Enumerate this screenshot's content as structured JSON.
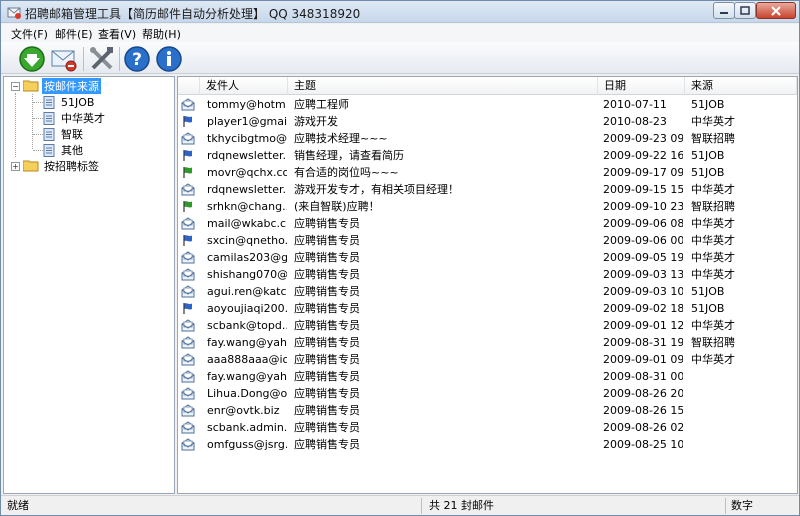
{
  "window": {
    "title": "招聘邮箱管理工具【简历邮件自动分析处理】 QQ 348318920"
  },
  "menu": [
    {
      "label": "文件(F)"
    },
    {
      "label": "邮件(E)"
    },
    {
      "label": "查看(V)"
    },
    {
      "label": "帮助(H)"
    }
  ],
  "toolbar": [
    {
      "icon": "download-icon"
    },
    {
      "icon": "mail-delete-icon"
    },
    {
      "icon": "tools-icon"
    },
    {
      "icon": "help-icon"
    },
    {
      "icon": "info-icon"
    }
  ],
  "tree": {
    "root1": "按邮件来源",
    "children": [
      "51JOB",
      "中华英才",
      "智联",
      "其他"
    ],
    "root2": "按招聘标签"
  },
  "list": {
    "columns": [
      "发件人",
      "主题",
      "日期",
      "来源"
    ],
    "rows": [
      {
        "icon": "mail-read-icon",
        "sender": "tommy@hotm...",
        "subject": "应聘工程师",
        "date": "2010-07-11",
        "source": "51JOB"
      },
      {
        "icon": "flag-blue-icon",
        "sender": "player1@gmai...",
        "subject": "游戏开发",
        "date": "2010-08-23",
        "source": "中华英才"
      },
      {
        "icon": "mail-read-icon",
        "sender": "tkhycibgtmo@...",
        "subject": "应聘技术经理~~~",
        "date": "2009-09-23 09...",
        "source": "智联招聘"
      },
      {
        "icon": "flag-blue-icon",
        "sender": "rdqnewsletter...",
        "subject": "销售经理，请查看简历",
        "date": "2009-09-22 16...",
        "source": "51JOB"
      },
      {
        "icon": "flag-green-icon",
        "sender": "movr@qchx.co...",
        "subject": "有合适的岗位吗~~~",
        "date": "2009-09-17 09...",
        "source": "51JOB"
      },
      {
        "icon": "mail-read-icon",
        "sender": "rdqnewsletter...",
        "subject": "游戏开发专才，有相关项目经理！",
        "date": "2009-09-15 15...",
        "source": "中华英才"
      },
      {
        "icon": "flag-green-icon",
        "sender": "srhkn@chang...",
        "subject": "(来自智联)应聘！",
        "date": "2009-09-10 23...",
        "source": "智联招聘"
      },
      {
        "icon": "mail-read-icon",
        "sender": "mail@wkabc.c...",
        "subject": "应聘销售专员",
        "date": "2009-09-06 08...",
        "source": "中华英才"
      },
      {
        "icon": "flag-blue-icon",
        "sender": "sxcin@qnetho...",
        "subject": "应聘销售专员",
        "date": "2009-09-06 00...",
        "source": "中华英才"
      },
      {
        "icon": "mail-read-icon",
        "sender": "camilas203@g...",
        "subject": "应聘销售专员",
        "date": "2009-09-05 19...",
        "source": "中华英才"
      },
      {
        "icon": "mail-read-icon",
        "sender": "shishang070@...",
        "subject": "应聘销售专员",
        "date": "2009-09-03 13...",
        "source": "中华英才"
      },
      {
        "icon": "mail-read-icon",
        "sender": "agui.ren@katc...",
        "subject": "应聘销售专员",
        "date": "2009-09-03 10...",
        "source": "51JOB"
      },
      {
        "icon": "flag-blue-icon",
        "sender": "aoyoujiaqi200...",
        "subject": "应聘销售专员",
        "date": "2009-09-02 18...",
        "source": "51JOB"
      },
      {
        "icon": "mail-read-icon",
        "sender": "scbank@topd...",
        "subject": "应聘销售专员",
        "date": "2009-09-01 12...",
        "source": "中华英才"
      },
      {
        "icon": "mail-read-icon",
        "sender": "fay.wang@yah...",
        "subject": "应聘销售专员",
        "date": "2009-08-31 19...",
        "source": "智联招聘"
      },
      {
        "icon": "mail-read-icon",
        "sender": "aaa888aaa@io...",
        "subject": "应聘销售专员",
        "date": "2009-09-01 09...",
        "source": "中华英才"
      },
      {
        "icon": "mail-read-icon",
        "sender": "fay.wang@yah...",
        "subject": "应聘销售专员",
        "date": "2009-08-31 00...",
        "source": ""
      },
      {
        "icon": "mail-read-icon",
        "sender": "Lihua.Dong@o...",
        "subject": "应聘销售专员",
        "date": "2009-08-26 20...",
        "source": ""
      },
      {
        "icon": "mail-read-icon",
        "sender": "enr@ovtk.biz",
        "subject": "应聘销售专员",
        "date": "2009-08-26 15...",
        "source": ""
      },
      {
        "icon": "mail-read-icon",
        "sender": "scbank.admin...",
        "subject": "应聘销售专员",
        "date": "2009-08-26 02...",
        "source": ""
      },
      {
        "icon": "mail-read-icon",
        "sender": "omfguss@jsrg...",
        "subject": "应聘销售专员",
        "date": "2009-08-25 10...",
        "source": ""
      }
    ]
  },
  "status": {
    "left": "就绪",
    "center": "共 21 封邮件",
    "right": "数字"
  }
}
